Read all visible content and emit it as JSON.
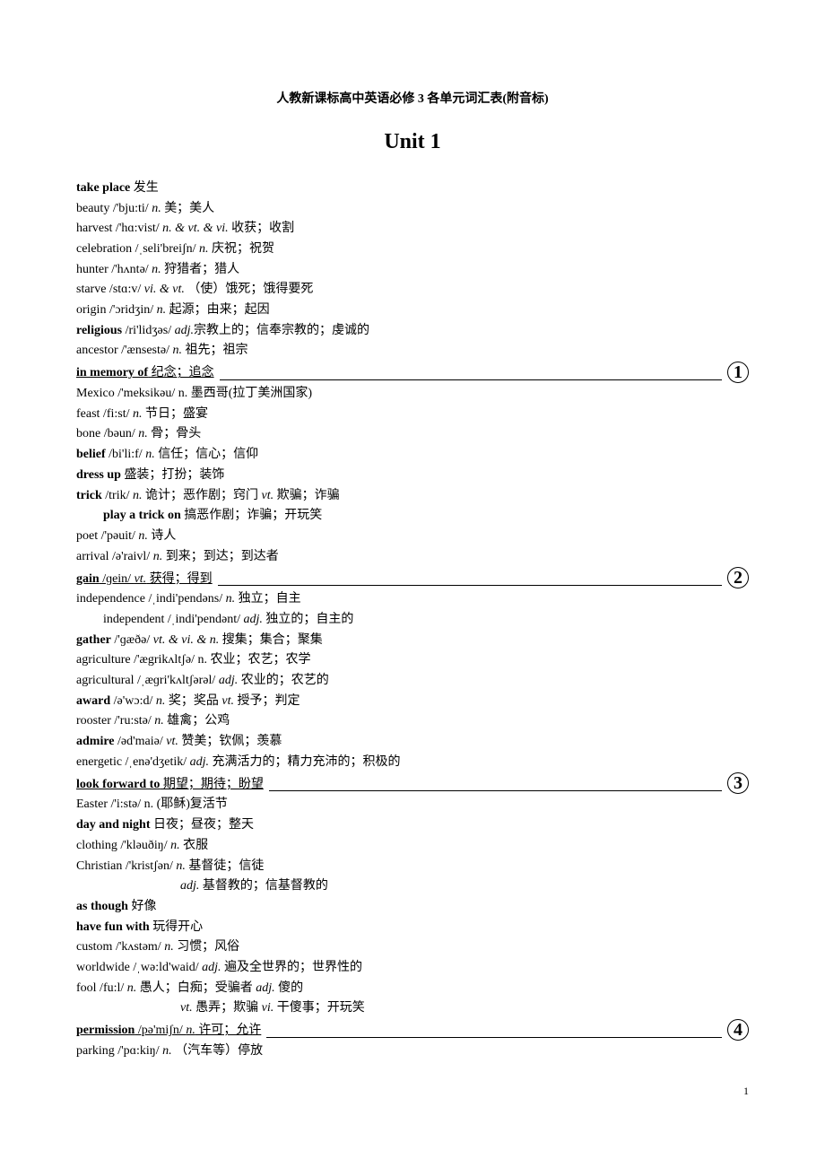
{
  "title": "人教新课标高中英语必修 3 各单元词汇表(附音标)",
  "unit": "Unit 1",
  "pageNumber": "1",
  "sections": [
    {
      "type": "plain",
      "lines": [
        [
          {
            "bold": true,
            "text": "take place"
          },
          {
            "text": "   发生"
          }
        ],
        [
          {
            "text": "beauty   /'bju:ti/   "
          },
          {
            "ital": true,
            "text": "n."
          },
          {
            "text": "  美；美人"
          }
        ],
        [
          {
            "text": "harvest   /'hɑ:vist/   "
          },
          {
            "ital": true,
            "text": "n. & vt. & vi."
          },
          {
            "text": "  收获；收割"
          }
        ],
        [
          {
            "text": "celebration    /ˌseli'breiʃn/   "
          },
          {
            "ital": true,
            "text": "n."
          },
          {
            "text": "  庆祝；祝贺"
          }
        ],
        [
          {
            "text": "hunter   /'hʌntə/   "
          },
          {
            "ital": true,
            "text": "n."
          },
          {
            "text": "  狩猎者；猎人"
          }
        ],
        [
          {
            "text": "starve   /stɑ:v/   "
          },
          {
            "ital": true,
            "text": "vi. & vt."
          },
          {
            "text": "  （使）饿死；饿得要死"
          }
        ],
        [
          {
            "text": "origin   /'ɔridʒin/   "
          },
          {
            "ital": true,
            "text": "n."
          },
          {
            "text": "  起源；由来；起因"
          }
        ],
        [
          {
            "bold": true,
            "text": "religious "
          },
          {
            "text": "/ri'lidʒəs/ "
          },
          {
            "ital": true,
            "text": "adj."
          },
          {
            "text": "宗教上的；信奉宗教的；虔诚的"
          }
        ],
        [
          {
            "text": "ancestor   /'ænsestə/   "
          },
          {
            "ital": true,
            "text": "n."
          },
          {
            "text": "  祖先；祖宗"
          }
        ]
      ]
    },
    {
      "type": "sep",
      "sepLine": [
        {
          "bold": true,
          "text": "in memory of"
        },
        {
          "text": "   纪念；追念"
        }
      ],
      "num": "1"
    },
    {
      "type": "plain",
      "lines": [
        [
          {
            "text": "Mexico   /'meksikəu/   n.  墨西哥(拉丁美洲国家)"
          }
        ],
        [
          {
            "text": "feast   /fi:st/   "
          },
          {
            "ital": true,
            "text": "n."
          },
          {
            "text": "  节日；盛宴"
          }
        ],
        [
          {
            "text": "bone   /bəun/   "
          },
          {
            "ital": true,
            "text": "n."
          },
          {
            "text": "  骨；骨头"
          }
        ],
        [
          {
            "bold": true,
            "text": "belief"
          },
          {
            "text": "   /bi'li:f/   "
          },
          {
            "ital": true,
            "text": "n."
          },
          {
            "text": "  信任；信心；信仰"
          }
        ],
        [
          {
            "bold": true,
            "text": "dress up"
          },
          {
            "text": "    盛装；打扮；装饰"
          }
        ],
        [
          {
            "bold": true,
            "text": "trick"
          },
          {
            "text": "   /trik/ "
          },
          {
            "ital": true,
            "text": "n."
          },
          {
            "text": "  诡计；恶作剧；窍门   "
          },
          {
            "ital": true,
            "text": "vt."
          },
          {
            "text": "  欺骗；诈骗"
          }
        ],
        [
          {
            "indent": true,
            "bold": true,
            "text": "play a trick on"
          },
          {
            "text": "   搞恶作剧；诈骗；开玩笑"
          }
        ],
        [
          {
            "text": "poet   /'pəuit/   "
          },
          {
            "ital": true,
            "text": "n."
          },
          {
            "text": "  诗人"
          }
        ],
        [
          {
            "text": "arrival   /ə'raivl/   "
          },
          {
            "ital": true,
            "text": "n."
          },
          {
            "text": "  到来；到达；到达者"
          }
        ]
      ]
    },
    {
      "type": "sep",
      "sepLine": [
        {
          "bold": true,
          "text": "gain"
        },
        {
          "text": "   /ɡein/   "
        },
        {
          "ital": true,
          "text": "vt."
        },
        {
          "text": "  获得；得到"
        }
      ],
      "num": "2"
    },
    {
      "type": "plain",
      "lines": [
        [
          {
            "text": "independence   /ˌindi'pendəns/   "
          },
          {
            "ital": true,
            "text": "n."
          },
          {
            "text": "  独立；自主"
          }
        ],
        [
          {
            "indent": true,
            "text": "independent   /ˌindi'pendənt/   "
          },
          {
            "ital": true,
            "text": "adj."
          },
          {
            "text": "  独立的；自主的"
          }
        ],
        [
          {
            "bold": true,
            "text": "gather"
          },
          {
            "text": "   /'ɡæðə/   "
          },
          {
            "ital": true,
            "text": "vt. & vi. & n."
          },
          {
            "text": "  搜集；集合；聚集"
          }
        ],
        [
          {
            "text": "agriculture   /'ægrikʌltʃə/   n.  农业；农艺；农学"
          }
        ],
        [
          {
            "text": "agricultural   /ˌæɡri'kʌltʃərəl/   "
          },
          {
            "ital": true,
            "text": "adj."
          },
          {
            "text": "  农业的；农艺的"
          }
        ],
        [
          {
            "bold": true,
            "text": "award"
          },
          {
            "text": "   /ə'wɔ:d/   "
          },
          {
            "ital": true,
            "text": "n."
          },
          {
            "text": "  奖；奖品     "
          },
          {
            "ital": true,
            "text": "vt."
          },
          {
            "text": "  授予；判定"
          }
        ],
        [
          {
            "text": "rooster   /'ru:stə/   "
          },
          {
            "ital": true,
            "text": "n."
          },
          {
            "text": "  雄禽；公鸡"
          }
        ],
        [
          {
            "bold": true,
            "text": "admire"
          },
          {
            "text": "   /əd'maiə/   "
          },
          {
            "ital": true,
            "text": "vt."
          },
          {
            "text": "  赞美；钦佩；羡慕"
          }
        ],
        [
          {
            "text": "energetic /ˌenə'dʒetik/   "
          },
          {
            "ital": true,
            "text": "adj."
          },
          {
            "text": "  充满活力的；精力充沛的；积极的"
          }
        ]
      ]
    },
    {
      "type": "sep",
      "sepLine": [
        {
          "bold": true,
          "text": "look forward to"
        },
        {
          "text": "   期望；期待；盼望"
        }
      ],
      "num": "3"
    },
    {
      "type": "plain",
      "lines": [
        [
          {
            "text": "Easter   /'i:stə/   n. (耶稣)复活节"
          }
        ],
        [
          {
            "bold": true,
            "text": "day and night"
          },
          {
            "text": "   日夜；昼夜；整天"
          }
        ],
        [
          {
            "text": "clothing   /'kləuðiŋ/ "
          },
          {
            "ital": true,
            "text": "n."
          },
          {
            "text": "  衣服"
          }
        ],
        [
          {
            "text": "Christian   /'kristʃən/   "
          },
          {
            "ital": true,
            "text": "n."
          },
          {
            "text": "  基督徒；信徒"
          }
        ],
        [
          {
            "indent2": true,
            "ital": true,
            "text": "adj."
          },
          {
            "text": "  基督教的；信基督教的"
          }
        ],
        [
          {
            "bold": true,
            "text": "as though"
          },
          {
            "text": "   好像"
          }
        ],
        [
          {
            "bold": true,
            "text": "have fun with"
          },
          {
            "text": "   玩得开心"
          }
        ],
        [
          {
            "text": "custom   /'kʌstəm/   "
          },
          {
            "ital": true,
            "text": "n."
          },
          {
            "text": "  习惯；风俗"
          }
        ],
        [
          {
            "text": "worldwide /ˌwə:ld'waid/ "
          },
          {
            "ital": true,
            "text": "adj."
          },
          {
            "text": "  遍及全世界的；世界性的"
          }
        ],
        [
          {
            "text": "fool   /fu:l/   "
          },
          {
            "ital": true,
            "text": "n."
          },
          {
            "text": "  愚人；白痴；受骗者    "
          },
          {
            "ital": true,
            "text": "adj."
          },
          {
            "text": "  傻的"
          }
        ],
        [
          {
            "indent2": true,
            "ital": true,
            "text": "vt."
          },
          {
            "text": "  愚弄；欺骗      "
          },
          {
            "ital": true,
            "text": "vi."
          },
          {
            "text": "  干傻事；开玩笑"
          }
        ]
      ]
    },
    {
      "type": "sep",
      "sepLine": [
        {
          "bold": true,
          "text": "permission"
        },
        {
          "text": "   /pə'miʃn/   "
        },
        {
          "ital": true,
          "text": "n."
        },
        {
          "text": "  许可；允许"
        }
      ],
      "num": "4"
    },
    {
      "type": "plain",
      "lines": [
        [
          {
            "text": "parking   /'pɑ:kiŋ/   "
          },
          {
            "ital": true,
            "text": "n."
          },
          {
            "text": "  （汽车等）停放"
          }
        ]
      ]
    }
  ]
}
